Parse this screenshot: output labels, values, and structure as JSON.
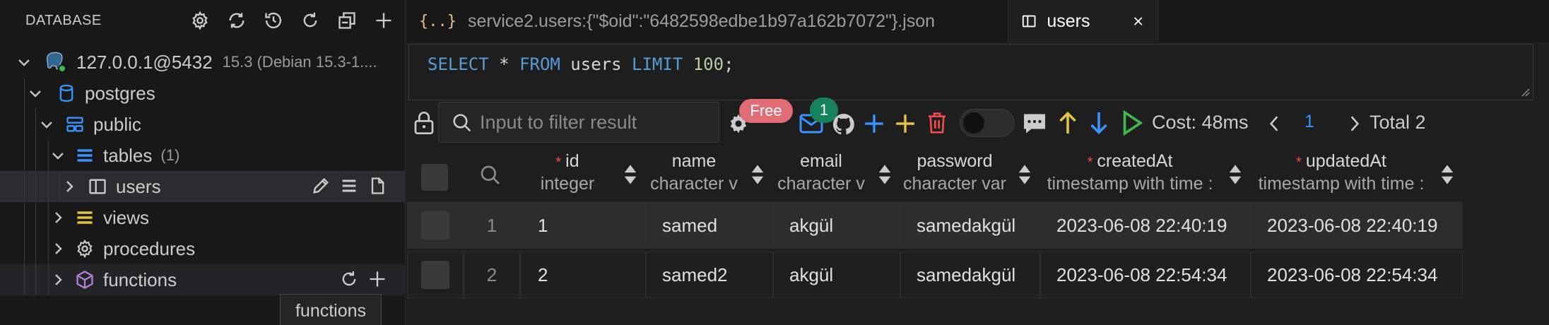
{
  "sidebar": {
    "title": "DATABASE",
    "header_icons": [
      "gear-icon",
      "refresh-icon",
      "history-icon",
      "reload-icon",
      "collapse-all-icon",
      "add-icon"
    ],
    "connection": {
      "host": "127.0.0.1@5432",
      "detail": "15.3 (Debian 15.3-1...."
    },
    "database": "postgres",
    "schema": "public",
    "tables": {
      "label": "tables",
      "count": "(1)"
    },
    "table_item": "users",
    "views": "views",
    "procedures": "procedures",
    "functions": "functions",
    "tooltip": "functions"
  },
  "tabs": [
    {
      "icon": "json-icon",
      "label": "service2.users:{\"$oid\":\"6482598edbe1b97a162b7072\"}.json",
      "active": false
    },
    {
      "icon": "table-icon",
      "label": "users",
      "active": true
    }
  ],
  "editor": {
    "sql": {
      "kw1": "SELECT",
      "star": " * ",
      "kw2": "FROM",
      "table": " users ",
      "kw3": "LIMIT",
      "space": " ",
      "limit": "100",
      "end": ";"
    }
  },
  "toolbar": {
    "filter_placeholder": "Input to filter result",
    "badge_free": "Free",
    "badge_count": "1",
    "cost": "Cost: 48ms",
    "page": "1",
    "total": "Total 2",
    "colors": {
      "add": "#3794ff",
      "plus_yellow": "#e2c541",
      "delete": "#f14c4c",
      "up": "#e2c541",
      "down": "#3794ff",
      "run": "#3fb950"
    }
  },
  "grid": {
    "columns": [
      {
        "name": "id",
        "type": "integer",
        "required": true
      },
      {
        "name": "name",
        "type": "character v",
        "required": false
      },
      {
        "name": "email",
        "type": "character v",
        "required": false
      },
      {
        "name": "password",
        "type": "character var",
        "required": false
      },
      {
        "name": "createdAt",
        "type": "timestamp with time :",
        "required": true
      },
      {
        "name": "updatedAt",
        "type": "timestamp with time :",
        "required": true
      }
    ],
    "rows": [
      {
        "index": "1",
        "id": "1",
        "name": "samed",
        "email": "akgül",
        "password": "samedakgül",
        "createdAt": "2023-06-08 22:40:19",
        "updatedAt": "2023-06-08 22:40:19"
      },
      {
        "index": "2",
        "id": "2",
        "name": "samed2",
        "email": "akgül",
        "password": "samedakgül",
        "createdAt": "2023-06-08 22:54:34",
        "updatedAt": "2023-06-08 22:54:34"
      }
    ]
  }
}
